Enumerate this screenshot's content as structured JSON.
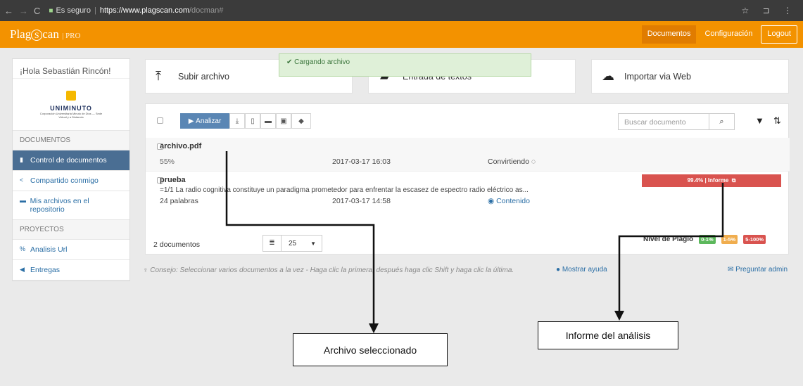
{
  "browser": {
    "secure_label": "Es seguro",
    "url_host": "https://www.plagscan.com",
    "url_path": "/docman#"
  },
  "app": {
    "logo_text": "Plag",
    "logo_s": "S",
    "logo_text2": "can",
    "logo_pro": "| PRO",
    "nav": {
      "documents": "Documentos",
      "settings": "Configuración",
      "logout": "Logout"
    }
  },
  "sidebar": {
    "greeting": "¡Hola Sebastián Rincón!",
    "org_name": "UNIMINUTO",
    "org_sub": "Corporación Universitaria Minuto de Dios — Sede Virtual y a Distancia",
    "section_docs": "DOCUMENTOS",
    "items_docs": [
      {
        "label": "Control de documentos",
        "icon": "file-icon",
        "active": true
      },
      {
        "label": "Compartido conmigo",
        "icon": "share-icon"
      },
      {
        "label": "Mis archivos en el repositorio",
        "icon": "archive-icon"
      }
    ],
    "section_projects": "PROYECTOS",
    "items_projects": [
      {
        "label": "Analisis Url",
        "icon": "link-icon"
      },
      {
        "label": "Entregas",
        "icon": "send-icon"
      }
    ]
  },
  "actions": {
    "upload": "Subir archivo",
    "text_entry": "Entrada de textos",
    "web_import": "Importar via Web"
  },
  "toast": {
    "text": "Cargando archivo"
  },
  "toolbar": {
    "analyze": "Analizar",
    "search_placeholder": "Buscar documento"
  },
  "documents": [
    {
      "name": "archivo.pdf",
      "progress": "55%",
      "date": "2017-03-17 16:03",
      "status": "Convirtiendo"
    },
    {
      "name": "prueba",
      "excerpt": "=1/1 La radio cognitiva constituye un paradigma prometedor para enfrentar la escasez de espectro radio eléctrico as...",
      "words": "24  palabras",
      "date": "2017-03-17 14:58",
      "content_link": "Contenido",
      "report": "99.4% | Informe"
    }
  ],
  "footer": {
    "count": "2 documentos",
    "per_page": "25",
    "plagio_label": "Nivel de Plagio",
    "badges": [
      {
        "text": "0-1%",
        "color": "#5cb85c"
      },
      {
        "text": "1-5%",
        "color": "#f0ad4e"
      },
      {
        "text": "5-100%",
        "color": "#d9534f"
      }
    ]
  },
  "tip": {
    "text": "Consejo: Seleccionar varios documentos a la vez - Haga clic la primera, después haga clic Shift y haga clic la última.",
    "help": "Mostrar ayuda",
    "ask_admin": "Preguntar admin"
  },
  "annotations": {
    "selected_file": "Archivo seleccionado",
    "analysis_report": "Informe del análisis"
  },
  "colors": {
    "brand": "#f39200",
    "accent": "#4a6e93",
    "danger": "#d9534f"
  }
}
